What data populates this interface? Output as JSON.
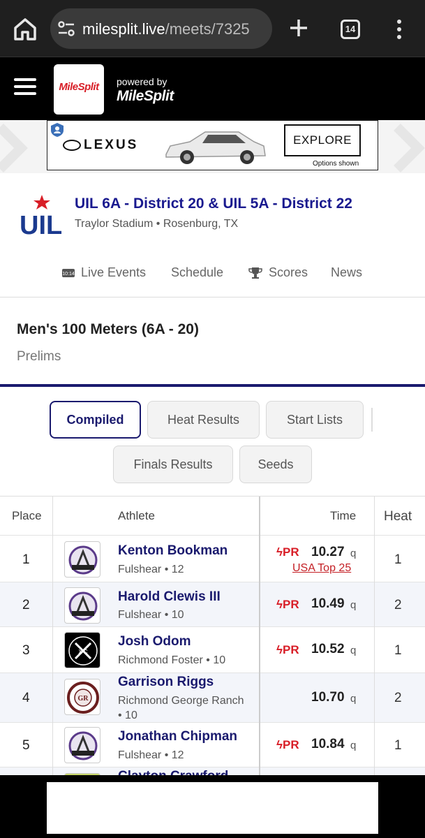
{
  "browser": {
    "url_host": "milesplit.live",
    "url_path": "/meets/7325",
    "tab_count": "14"
  },
  "site": {
    "logo_text": "MileSplit",
    "powered_by": "powered by",
    "powered_logo": "MileSplit"
  },
  "ad": {
    "brand": "LEXUS",
    "cta": "EXPLORE",
    "disclaimer": "Options shown"
  },
  "meet": {
    "title": "UIL 6A - District 20 & UIL 5A - District 22",
    "venue": "Traylor Stadium • Rosenburg, TX",
    "nav": [
      {
        "label": "Live Events",
        "icon": "live-clock-icon"
      },
      {
        "label": "Schedule"
      },
      {
        "label": "Scores",
        "icon": "trophy-icon"
      },
      {
        "label": "News"
      }
    ]
  },
  "event": {
    "title": "Men's 100 Meters (6A - 20)",
    "round": "Prelims"
  },
  "tabs": [
    "Compiled",
    "Heat Results",
    "Start Lists",
    "Finals Results",
    "Seeds"
  ],
  "table": {
    "headers": {
      "place": "Place",
      "athlete": "Athlete",
      "time": "Time",
      "heat": "Heat"
    },
    "rows": [
      {
        "place": "1",
        "name": "Kenton Bookman",
        "team": "Fulshear • 12",
        "pr": "PR",
        "time": "10.27",
        "q": "q",
        "rank": "USA Top 25",
        "heat": "1"
      },
      {
        "place": "2",
        "name": "Harold Clewis III",
        "team": "Fulshear • 10",
        "pr": "PR",
        "time": "10.49",
        "q": "q",
        "heat": "2"
      },
      {
        "place": "3",
        "name": "Josh Odom",
        "team": "Richmond Foster • 10",
        "pr": "PR",
        "time": "10.52",
        "q": "q",
        "heat": "1"
      },
      {
        "place": "4",
        "name": "Garrison Riggs",
        "team": "Richmond George Ranch • 10",
        "pr": "",
        "time": "10.70",
        "q": "q",
        "heat": "2"
      },
      {
        "place": "5",
        "name": "Jonathan Chipman",
        "team": "Fulshear • 12",
        "pr": "PR",
        "time": "10.84",
        "q": "q",
        "heat": "1"
      },
      {
        "place": "",
        "name": "Clayton Crawford",
        "team": "",
        "pr": "",
        "time": "",
        "q": "",
        "heat": ""
      }
    ]
  },
  "colors": {
    "navy": "#1a1a6e",
    "red": "#d81e27",
    "title_blue": "#1a1a8f"
  }
}
